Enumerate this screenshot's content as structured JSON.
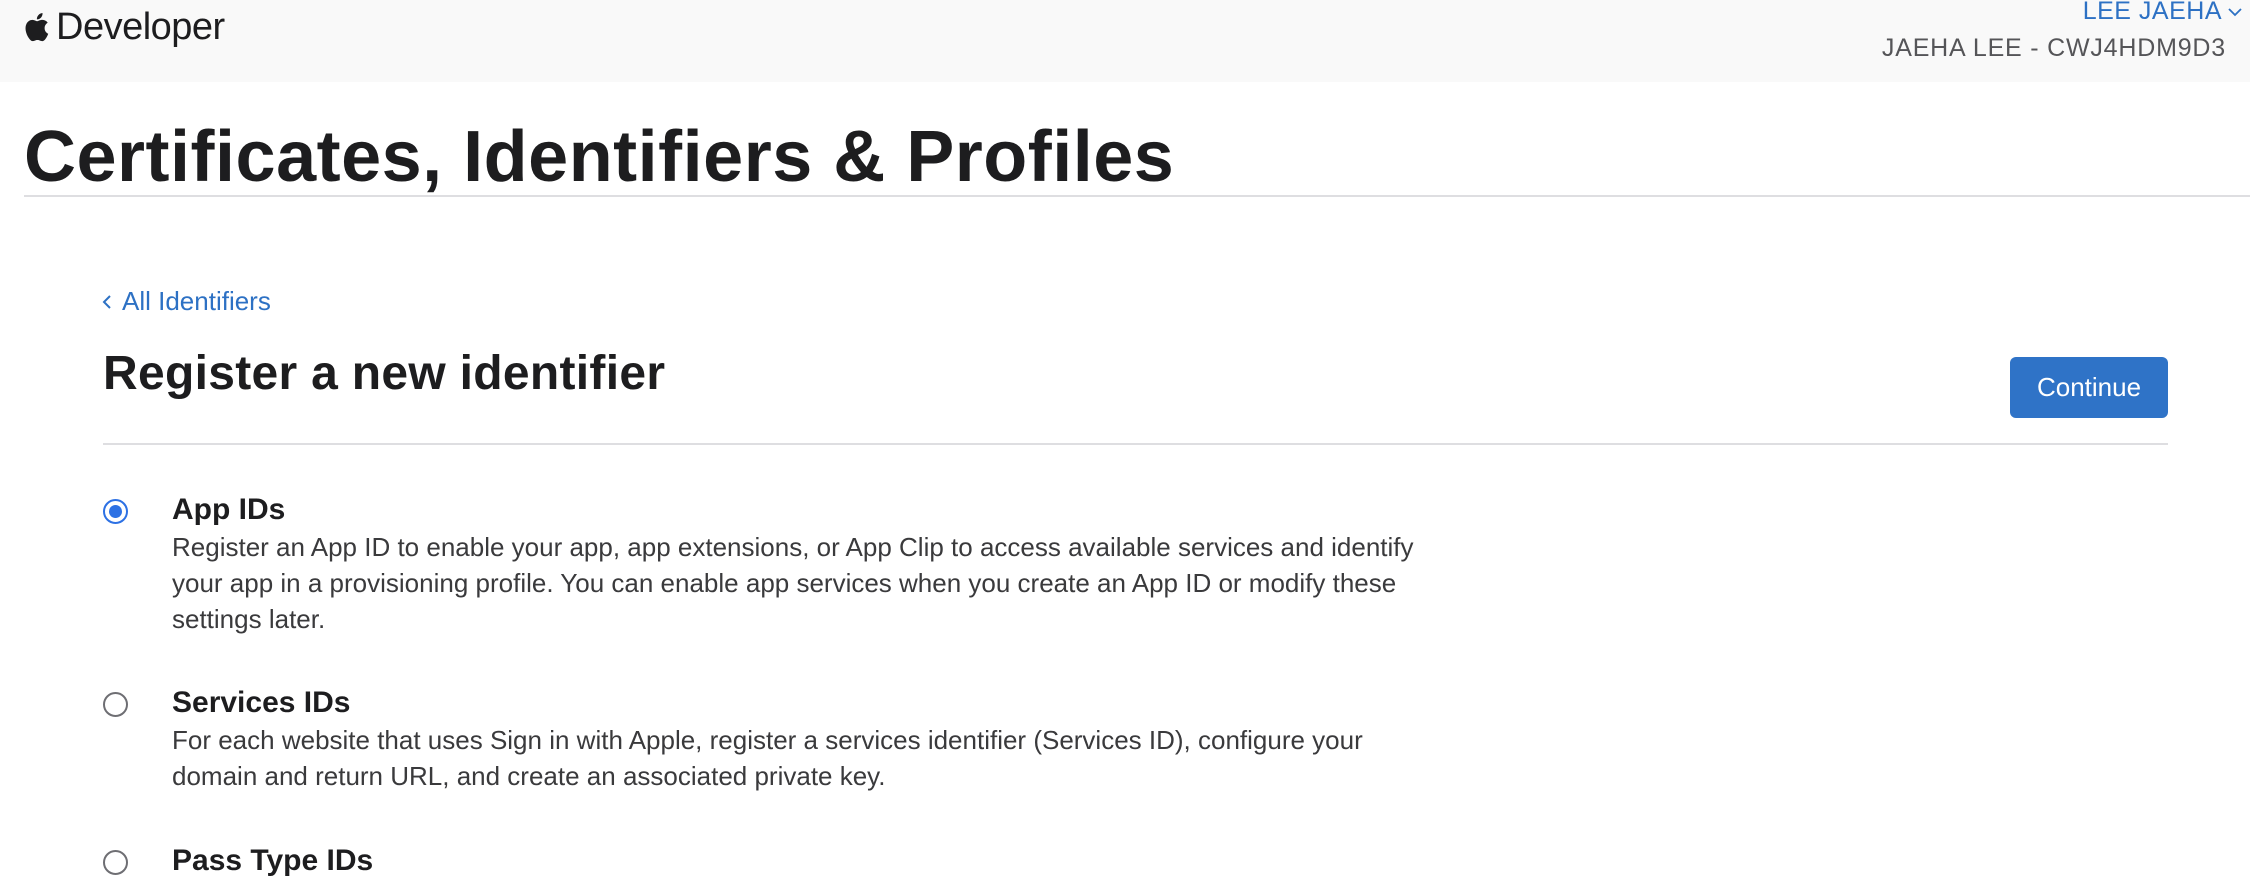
{
  "header": {
    "brand": "Developer",
    "account_name": "LEE JAEHA",
    "team": "JAEHA LEE - CWJ4HDM9D3"
  },
  "page": {
    "title": "Certificates, Identifiers & Profiles"
  },
  "section": {
    "back_link": "All Identifiers",
    "title": "Register a new identifier",
    "continue_label": "Continue"
  },
  "options": [
    {
      "title": "App IDs",
      "selected": true,
      "description": "Register an App ID to enable your app, app extensions, or App Clip to access available services and identify\nyour app in a provisioning profile. You can enable app services when you create an App ID or modify these\nsettings later."
    },
    {
      "title": "Services IDs",
      "selected": false,
      "description": "For each website that uses Sign in with Apple, register a services identifier (Services ID), configure your\ndomain and return URL, and create an associated private key."
    },
    {
      "title": "Pass Type IDs",
      "selected": false,
      "description": ""
    }
  ],
  "colors": {
    "accent": "#2f73c7",
    "link": "#2d71c4",
    "radio_selected": "#2d71e4"
  }
}
